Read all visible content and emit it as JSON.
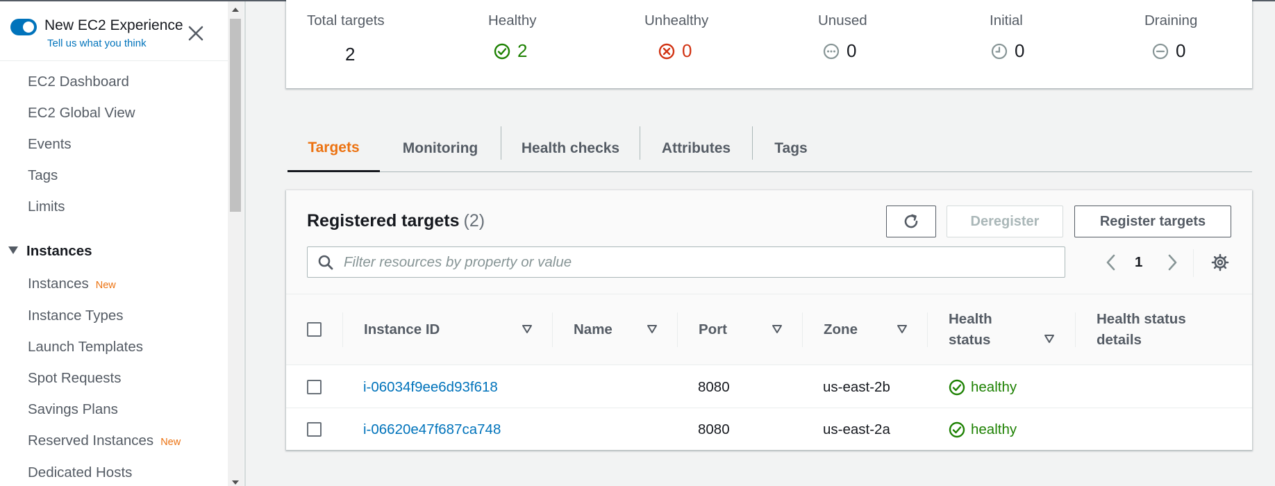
{
  "sidebar": {
    "experience_title": "New EC2 Experience",
    "experience_link": "Tell us what you think",
    "items_top": [
      "EC2 Dashboard",
      "EC2 Global View",
      "Events",
      "Tags",
      "Limits"
    ],
    "section": "Instances",
    "items_instances": [
      {
        "label": "Instances",
        "badge": "New"
      },
      {
        "label": "Instance Types",
        "badge": ""
      },
      {
        "label": "Launch Templates",
        "badge": ""
      },
      {
        "label": "Spot Requests",
        "badge": ""
      },
      {
        "label": "Savings Plans",
        "badge": ""
      },
      {
        "label": "Reserved Instances",
        "badge": "New"
      },
      {
        "label": "Dedicated Hosts",
        "badge": ""
      }
    ],
    "toggle_on": true
  },
  "summary": {
    "total_label": "Total targets",
    "total_value": "2",
    "healthy_label": "Healthy",
    "healthy_value": "2",
    "unhealthy_label": "Unhealthy",
    "unhealthy_value": "0",
    "unused_label": "Unused",
    "unused_value": "0",
    "initial_label": "Initial",
    "initial_value": "0",
    "draining_label": "Draining",
    "draining_value": "0"
  },
  "tabs": [
    "Targets",
    "Monitoring",
    "Health checks",
    "Attributes",
    "Tags"
  ],
  "active_tab": "Targets",
  "panel": {
    "title": "Registered targets",
    "count": "(2)",
    "deregister_label": "Deregister",
    "register_label": "Register targets",
    "search_placeholder": "Filter resources by property or value",
    "page_number": "1"
  },
  "table": {
    "columns": {
      "instance_id": "Instance ID",
      "name": "Name",
      "port": "Port",
      "zone": "Zone",
      "health_status_1": "Health",
      "health_status_2": "status",
      "health_details_1": "Health status",
      "health_details_2": "details"
    },
    "rows": [
      {
        "instance_id": "i-06034f9ee6d93f618",
        "name": "",
        "port": "8080",
        "zone": "us-east-2b",
        "health": "healthy",
        "details": ""
      },
      {
        "instance_id": "i-06620e47f687ca748",
        "name": "",
        "port": "8080",
        "zone": "us-east-2a",
        "health": "healthy",
        "details": ""
      }
    ]
  },
  "colors": {
    "accent_orange": "#ec7211",
    "link_blue": "#0073bb",
    "healthy_green": "#1d8102",
    "unhealthy_red": "#d13212",
    "neutral_gray": "#687078"
  }
}
